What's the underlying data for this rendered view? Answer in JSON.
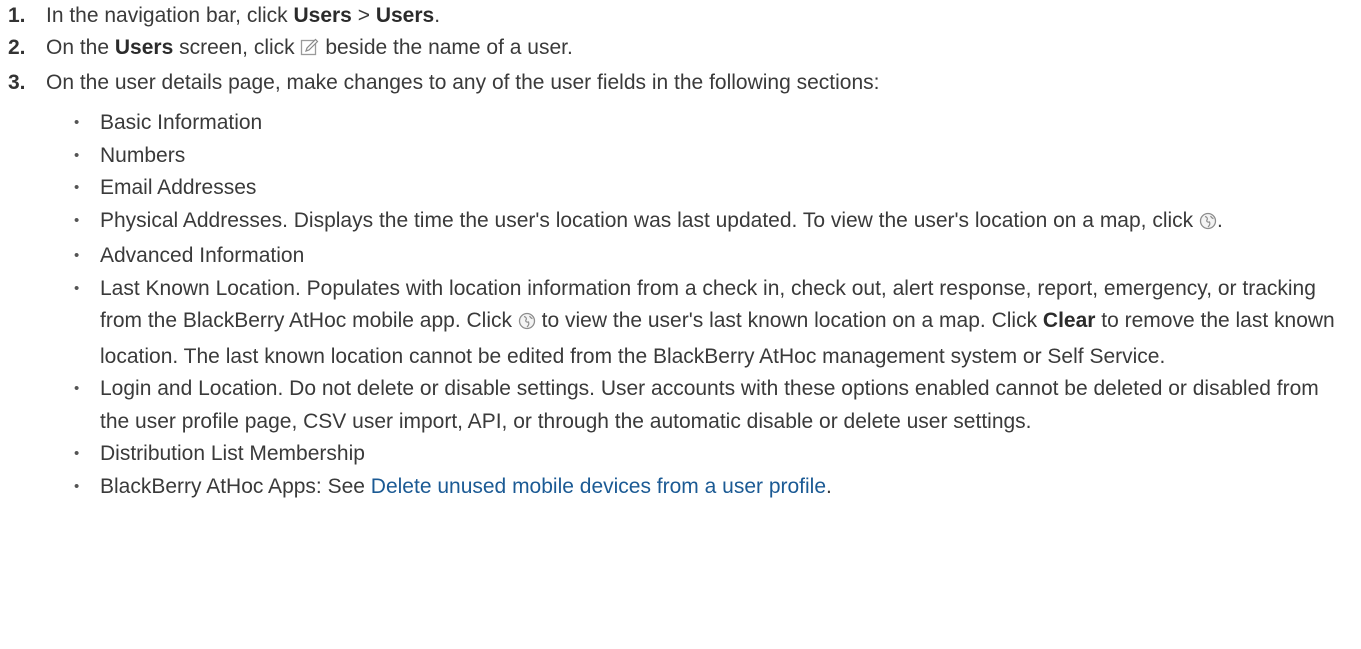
{
  "steps": [
    {
      "num": "1.",
      "t1": "In the navigation bar, click ",
      "b1": "Users",
      "t2": " > ",
      "b2": "Users",
      "t3": "."
    },
    {
      "num": "2.",
      "t1": "On the ",
      "b1": "Users",
      "t2": " screen, click ",
      "t3": " beside the name of a user."
    },
    {
      "num": "3.",
      "t1": "On the user details page, make changes to any of the user fields in the following sections:"
    }
  ],
  "bullets": [
    {
      "text": "Basic Information"
    },
    {
      "text": "Numbers"
    },
    {
      "text": "Email Addresses"
    },
    {
      "t1": "Physical Addresses. Displays the time the user's location was last updated. To view the user's location on a map, click ",
      "t2": "."
    },
    {
      "text": "Advanced Information"
    },
    {
      "t1": "Last Known Location. Populates with location information from a check in, check out, alert response, report, emergency, or tracking from the BlackBerry AtHoc mobile app. Click ",
      "t2": " to view the user's last known location on a map. Click ",
      "b1": "Clear",
      "t3": " to remove the last known location. The last known location cannot be edited from the BlackBerry AtHoc management system or Self Service."
    },
    {
      "text": "Login and Location. Do not delete or disable settings. User accounts with these options enabled cannot be deleted or disabled from the user profile page, CSV user import, API, or through the automatic disable or delete user settings."
    },
    {
      "text": "Distribution List Membership"
    },
    {
      "t1": "BlackBerry AtHoc Apps: See ",
      "link": "Delete unused mobile devices from a user profile",
      "t2": "."
    }
  ],
  "icons": {
    "edit": "edit-icon",
    "globe": "globe-icon"
  },
  "colors": {
    "text": "#3a3a3a",
    "link": "#1b5a94"
  }
}
